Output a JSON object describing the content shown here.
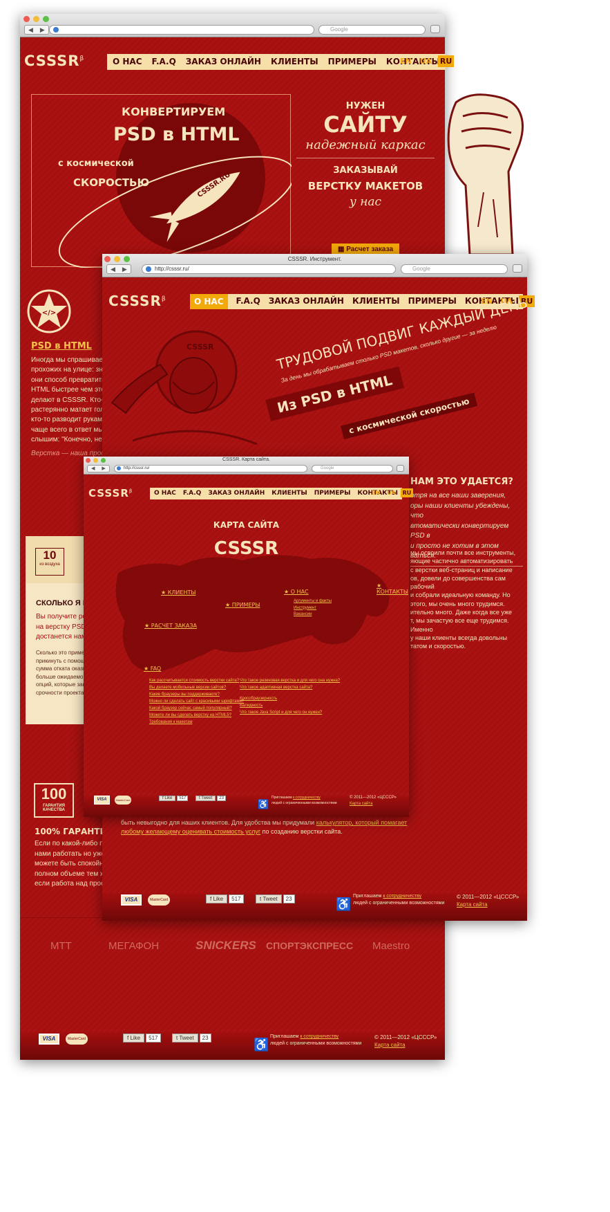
{
  "win1": {
    "search_placeholder": "Google",
    "logo": "CSSSR",
    "logo_sup": "β",
    "menu": [
      "О НАС",
      "F.A.Q",
      "ЗАКАЗ ОНЛАЙН",
      "КЛИЕНТЫ",
      "ПРИМЕРЫ",
      "КОНТАКТЫ"
    ],
    "langs": [
      "EN",
      "UA",
      "RU"
    ],
    "hero": {
      "line1": "КОНВЕРТИРУЕМ",
      "line2": "PSD в HTML",
      "line3": "с космической",
      "line4": "СКОРОСТЬЮ",
      "rocket_label": "CSSSR.RU"
    },
    "promo": {
      "p1": "НУЖЕН",
      "p2": "САЙТУ",
      "p3": "надежный каркас",
      "p4": "ЗАКАЗЫВАЙ",
      "p5": "ВЕРСТКУ МАКЕТОВ",
      "p6": "у нас",
      "btn": "Расчет заказа"
    },
    "section1": {
      "title": "PSD в HTML",
      "text": [
        "Иногда мы спрашиваем",
        "прохожих на улице: знают",
        "они способ превратить P",
        "HTML быстрее чем это",
        "делают в CSSSR. Кто-то",
        "растерянно матает голово",
        "кто-то разводит руками,",
        "чаще всего в ответ мы",
        "слышим: \"Конечно, нет!\""
      ],
      "note": "Верстка — наша профе"
    },
    "badge10": {
      "big": "10",
      "small": "из воздуха"
    },
    "section2": {
      "title": "СКОЛЬКО Я ПОЛ",
      "text": [
        "Вы получите ровно",
        "на верстку PSD в HT",
        "достанется нам бла"
      ],
      "small": [
        "Сколько это пример",
        "прикинуть с помощь",
        "сумма отката оказы",
        "больше ожидаемой,",
        "опций, которые зака",
        "срочности проекта."
      ]
    },
    "badge100": {
      "big": "100",
      "small": "ГАРАНТИЯ КАЧЕСТВА"
    },
    "section3": {
      "title": "100% ГАРАНТИЯ КА",
      "text": [
        "Если по какой-либо прич",
        "нами работать но уже с",
        "можете быть спокойны,",
        "полном объеме тем же с",
        "если работа над проект"
      ]
    },
    "partners": [
      "МТТ",
      "МЕГАФОН",
      "SNICKERS",
      "СПОРТЭКСПРЕСС",
      "Maestro"
    ],
    "footer": {
      "visa": "VISA",
      "mc": "MasterCard",
      "like": "Like",
      "like_count": "517",
      "tweet": "Tweet",
      "tweet_count": "23",
      "invite": "Приглашаем",
      "invite_link": "к сотрудничеству",
      "invite2": "людей с ограниченными возможностями",
      "copy": "© 2011—2012 «ЦСССР»",
      "sitemap": "Карта сайта"
    }
  },
  "win2": {
    "title": "CSSSR. Инструмент.",
    "url": "http://csssr.ru/",
    "search_placeholder": "Google",
    "headline": "ТРУДОВОЙ ПОДВИГ КАЖДЫЙ ДЕНЬ",
    "subline": "За день мы обрабатываем столько PSD макетов, сколько другие — за неделю",
    "banner1": "Из PSD в HTML",
    "banner2": "с космической скоростью",
    "helmet_label": "CSSSR",
    "how_title": "НАМ ЭТО УДАЕТСЯ?",
    "how_text": [
      "отря на все наши заверения,",
      "оры наши клиенты убеждены, что",
      "втоматически конвертируем PSD в",
      "и просто не хотим в этом",
      "ваться."
    ],
    "body_text": [
      "мы освоили почти все инструменты,",
      "яющие частично автоматизировать",
      "с верстки веб-страниц и написание",
      "ов, довели до совершенства сам рабочий",
      "и собрали идеальную команду. Но",
      "этого, мы очень много трудимся.",
      "ительно много. Даже когда все уже",
      "т, мы зачастую все еще трудимся. Именно",
      "у наши клиенты всегда довольны",
      "татом и скоростью."
    ],
    "bottom_text_a": "быть невыгодно для наших клиентов. Для удобства мы придумали",
    "bottom_link1": "калькулятор, который помагает",
    "bottom_link2": "любому желающему оценивать стоимость услуг",
    "bottom_text_b": "по созданию верстки сайта."
  },
  "win3": {
    "title": "CSSSR. Карта сайта.",
    "url": "http://csssr.ru/",
    "search_placeholder": "Google",
    "map_title": "КАРТА САЙТА",
    "map_logo": "CSSSR",
    "points": {
      "clients": "КЛИЕНТЫ",
      "examples": "ПРИМЕРЫ",
      "about": "О НАС",
      "contacts": "КОНТАКТЫ",
      "order": "РАСЧЕТ ЗАКАЗА",
      "faq": "FAQ"
    },
    "about_sub": [
      "Аргументы и факты",
      "Инструмент",
      "Вакансии"
    ],
    "faq_left": [
      "Как рассчитывается стоимость верстки сайта?",
      "Вы делаете мобильные версии сайтов?",
      "Какие браузеры вы поддерживаете?",
      "Можно ли сделать сайт с красивыми шрифтами?",
      "Какой браузер сейчас самый популярный?",
      "Можете ли вы сделать верстку на HTML5?",
      "Требования к макетам"
    ],
    "faq_right": [
      "Что такое резиновая верстка и для чего она нужна?",
      "Что такое адаптивная верстка сайта?",
      "Кроссбраузерность",
      "Валидность",
      "Что такое Java Script и для чего он нужен?"
    ]
  }
}
